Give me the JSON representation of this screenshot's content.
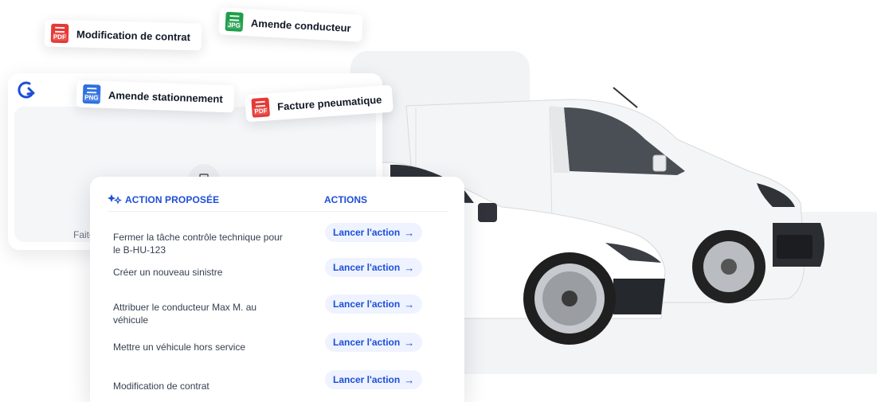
{
  "files": [
    {
      "type": "PDF",
      "name": "Modification de contrat",
      "color": "#e53935"
    },
    {
      "type": "JPG",
      "name": "Amende conducteur",
      "color": "#1e9e4a"
    },
    {
      "type": "PNG",
      "name": "Amende stationnement",
      "color": "#2f6fe0"
    },
    {
      "type": "PDF",
      "name": "Facture pneumatique",
      "color": "#e53935"
    }
  ],
  "upload": {
    "hint": "Faites"
  },
  "action_card": {
    "col_left": "ACTION PROPOSÉE",
    "col_right": "ACTIONS",
    "button_label": "Lancer l'action",
    "button_arrow": "→",
    "rows": [
      {
        "text": "Fermer la tâche contrôle technique pour le B-HU-123"
      },
      {
        "text": "Créer un nouveau sinistre"
      },
      {
        "text": "Attribuer le conducteur Max M. au véhicule"
      },
      {
        "text": "Mettre un véhicule hors service"
      },
      {
        "text": "Modification de contrat"
      }
    ]
  },
  "colors": {
    "accent": "#1d4ed8",
    "button_bg": "#eef3ff"
  }
}
